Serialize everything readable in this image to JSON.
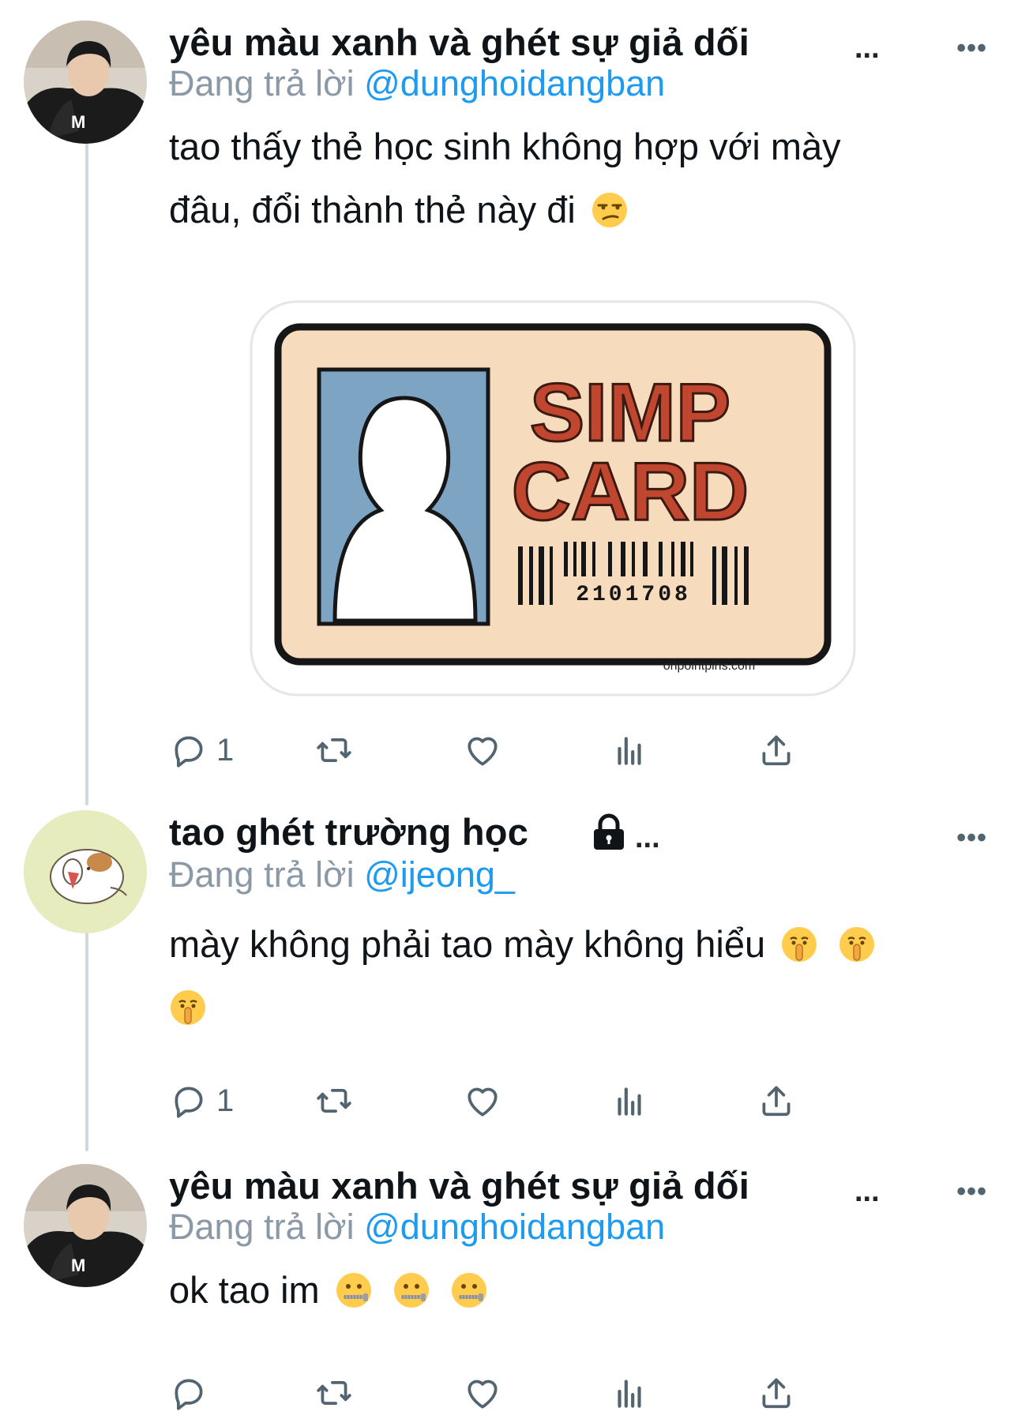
{
  "tweets": [
    {
      "author": "yêu màu xanh và ghét sự giả dối",
      "name_ellipsis": "...",
      "more": "•••",
      "reply_prefix": "Đang trả lời",
      "reply_handle": "@dunghoidangban",
      "text_line1": "tao thấy thẻ học sinh không hợp với mày",
      "text_line2": "đâu, đổi thành thẻ này đi",
      "reply_count": "1",
      "media": {
        "title_line1": "SIMP",
        "title_line2": "CARD",
        "barcode_number": "2101708",
        "watermark": "onpointpins.com"
      }
    },
    {
      "author": "tao ghét trường học",
      "name_ellipsis": "...",
      "more": "•••",
      "reply_prefix": "Đang trả lời",
      "reply_handle": "@ijeong_",
      "text_line1": "mày không phải tao mày không hiểu",
      "reply_count": "1"
    },
    {
      "author": "yêu màu xanh và ghét sự giả dối",
      "name_ellipsis": "...",
      "more": "•••",
      "reply_prefix": "Đang trả lời",
      "reply_handle": "@dunghoidangban",
      "text_line1": "ok tao im",
      "reply_count": ""
    }
  ],
  "colors": {
    "link": "#1d9bf0",
    "secondary": "#8b98a5",
    "icon": "#536471",
    "thread_line": "#cfd9de"
  },
  "icons": [
    "reply-icon",
    "retweet-icon",
    "like-icon",
    "views-icon",
    "share-icon",
    "lock-icon"
  ]
}
